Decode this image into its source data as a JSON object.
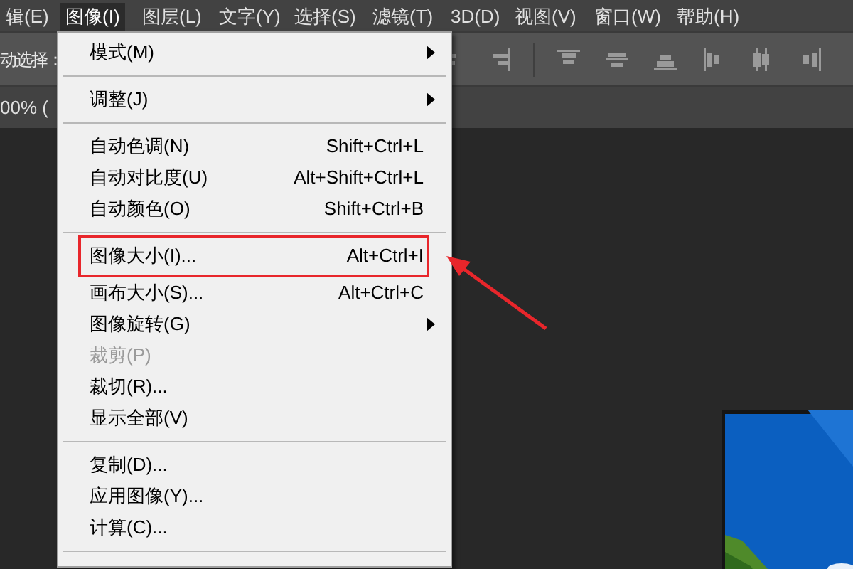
{
  "menubar": [
    {
      "label": "辑(E)",
      "selected": false
    },
    {
      "label": "图像(I)",
      "selected": true
    },
    {
      "label": "图层(L)",
      "selected": false
    },
    {
      "label": "文字(Y)",
      "selected": false
    },
    {
      "label": "选择(S)",
      "selected": false
    },
    {
      "label": "滤镜(T)",
      "selected": false
    },
    {
      "label": "3D(D)",
      "selected": false
    },
    {
      "label": "视图(V)",
      "selected": false
    },
    {
      "label": "窗口(W)",
      "selected": false
    },
    {
      "label": "帮助(H)",
      "selected": false
    }
  ],
  "options_bar": {
    "label": "动选择："
  },
  "document_tab": {
    "label": "00% ("
  },
  "menu": {
    "items": [
      {
        "kind": "item",
        "label": "模式(M)",
        "submenu": true,
        "disabled": false
      },
      {
        "kind": "separator"
      },
      {
        "kind": "item",
        "label": "调整(J)",
        "submenu": true,
        "disabled": false
      },
      {
        "kind": "separator"
      },
      {
        "kind": "item",
        "label": "自动色调(N)",
        "shortcut": "Shift+Ctrl+L",
        "submenu": false,
        "disabled": false
      },
      {
        "kind": "item",
        "label": "自动对比度(U)",
        "shortcut": "Alt+Shift+Ctrl+L",
        "submenu": false,
        "disabled": false
      },
      {
        "kind": "item",
        "label": "自动颜色(O)",
        "shortcut": "Shift+Ctrl+B",
        "submenu": false,
        "disabled": false
      },
      {
        "kind": "separator"
      },
      {
        "kind": "item",
        "label": "图像大小(I)...",
        "shortcut": "Alt+Ctrl+I",
        "submenu": false,
        "disabled": false,
        "highlighted": true
      },
      {
        "kind": "item",
        "label": "画布大小(S)...",
        "shortcut": "Alt+Ctrl+C",
        "submenu": false,
        "disabled": false
      },
      {
        "kind": "item",
        "label": "图像旋转(G)",
        "submenu": true,
        "disabled": false
      },
      {
        "kind": "item",
        "label": "裁剪(P)",
        "submenu": false,
        "disabled": true
      },
      {
        "kind": "item",
        "label": "裁切(R)...",
        "submenu": false,
        "disabled": false
      },
      {
        "kind": "item",
        "label": "显示全部(V)",
        "submenu": false,
        "disabled": false
      },
      {
        "kind": "separator"
      },
      {
        "kind": "item",
        "label": "复制(D)...",
        "submenu": false,
        "disabled": false
      },
      {
        "kind": "item",
        "label": "应用图像(Y)...",
        "submenu": false,
        "disabled": false
      },
      {
        "kind": "item",
        "label": "计算(C)...",
        "submenu": false,
        "disabled": false
      },
      {
        "kind": "separator"
      }
    ]
  }
}
